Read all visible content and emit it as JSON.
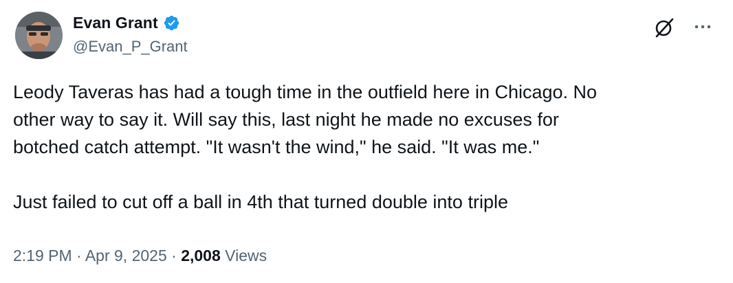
{
  "author": {
    "display_name": "Evan Grant",
    "handle": "@Evan_P_Grant",
    "verified": true
  },
  "icons": {
    "verified": "verified-badge-icon",
    "grok": "grok-icon",
    "more": "more-options-icon"
  },
  "tweet": {
    "text": "Leody Taveras has had a tough time in the outfield here in Chicago. No\nother way to say it. Will say this, last night he made no excuses for\nbotched catch attempt. \"It wasn't the wind,\" he said. \"It was me.\"\n\nJust failed to cut off a ball in 4th that turned double into triple"
  },
  "meta": {
    "time": "2:19 PM",
    "separator1": " · ",
    "date": "Apr 9, 2025",
    "separator2": " · ",
    "views_count": "2,008",
    "views_label": " Views"
  },
  "colors": {
    "text_primary": "#0f1419",
    "text_secondary": "#536471",
    "verified_blue": "#1d9bf0"
  }
}
